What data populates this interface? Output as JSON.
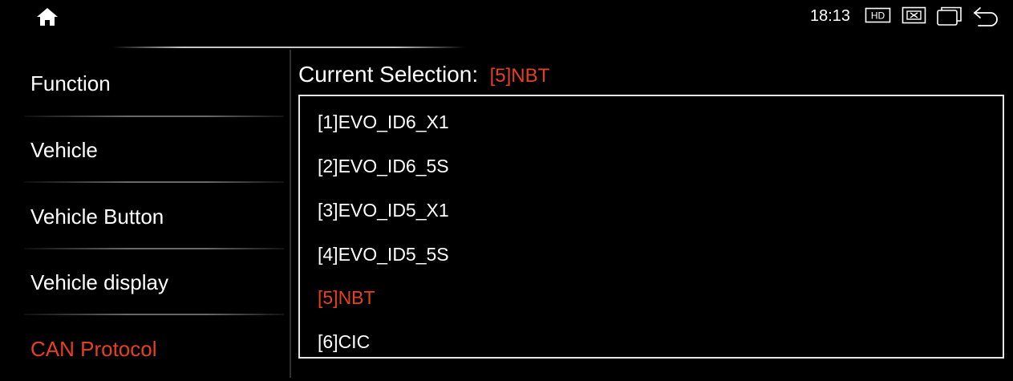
{
  "status_bar": {
    "time": "18:13",
    "icons": [
      "home-icon",
      "hd-icon",
      "close-box-icon",
      "window-icon",
      "back-icon"
    ],
    "hd_label": "HD"
  },
  "sidebar": {
    "items": [
      {
        "label": "Function",
        "active": false
      },
      {
        "label": "Vehicle",
        "active": false
      },
      {
        "label": "Vehicle Button",
        "active": false
      },
      {
        "label": "Vehicle display",
        "active": false
      },
      {
        "label": "CAN Protocol",
        "active": true
      }
    ]
  },
  "main": {
    "current_selection_label": "Current Selection:",
    "current_selection_value": "[5]NBT",
    "options": [
      {
        "label": "[1]EVO_ID6_X1",
        "selected": false
      },
      {
        "label": "[2]EVO_ID6_5S",
        "selected": false
      },
      {
        "label": "[3]EVO_ID5_X1",
        "selected": false
      },
      {
        "label": "[4]EVO_ID5_5S",
        "selected": false
      },
      {
        "label": "[5]NBT",
        "selected": true
      },
      {
        "label": "[6]CIC",
        "selected": false
      }
    ]
  },
  "colors": {
    "background": "#000000",
    "text": "#ffffff",
    "accent": "#e8401f"
  }
}
